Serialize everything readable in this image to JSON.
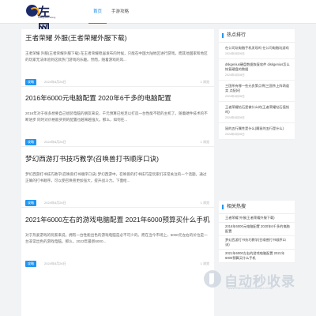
{
  "header": {
    "logo_text": "左网",
    "logo_sub": "Wang Zuo Wang",
    "nav": [
      "首页",
      "手游攻略"
    ]
  },
  "posts": [
    {
      "title": "王者荣耀 外服(王者荣耀外服下载)",
      "excerpt": "王者荣耀 外服(王者荣耀外服下载) 在王者荣耀稳居发布的时候，只能在中国大陆地区进行游戏，而其他国家和地区的玩家无法体验到这款热门游戏的乐趣。然而，随着游戏的风...",
      "tag": "攻略",
      "date": "2024年8月26日",
      "views": "1 浏览"
    },
    {
      "title": "2016年6000元电脑配置 2020年6千多的电脑配置",
      "excerpt": "2016年对于很多想要自己组装电脑的朋友来说，千元预算已经足以打造一台性能不错的主机了。随着硬件技术的不断进步 同时对价格能买到的配置也越来越强大。那么，如何在...",
      "tag": "攻略",
      "date": "2024年8月26日",
      "views": "1 浏览"
    },
    {
      "title": "梦幻西游打书技巧教学(召唤兽打书顺序口诀)",
      "excerpt": "梦幻西游打书技巧教学(召唤兽打书顺序口诀) 梦幻西游中，召唤兽的打书技巧是玩家们非常关注的一个话题。通过正确的打书顺序，可以使召唤兽更加强大，提升战斗力。下面给...",
      "tag": "攻略",
      "date": "2024年8月26日",
      "views": "1 浏览"
    },
    {
      "title": "2021年6000左右的游戏电脑配置 2021年6000预算买什么手机",
      "excerpt": "对于热爱游戏的玩家来说，拥有一台性能出色的游戏电脑是必不可少的。而在当今市场上，6000元左右的价位是一台非常出色的游戏电脑。那么，2023年最新6000...",
      "tag": "攻略",
      "date": "2024年8月26日",
      "views": "1 浏览"
    }
  ],
  "hot": {
    "heading": "热点排行",
    "items": [
      {
        "title": "在公司玩电脑手机发现吗 在公司电脑玩游戏",
        "date": "2024年8月26日"
      },
      {
        "title": "dskgenius硬盘数据恢复软件 diskgenius怎么恢复硬盘的数据",
        "date": "2024年8月26日"
      },
      {
        "title": "三国杀有哪一些元良策点将(三国杀上阵两道卖 点配好)",
        "date": "2024年8月26日"
      },
      {
        "title": "王者荣耀钻石是做什么的(王者荣耀钻石值钱吗)",
        "date": "2024年8月26日"
      },
      {
        "title": "鼠的五行属性是什么(属鼠的五行是什么)",
        "date": "2024年8月26日"
      }
    ]
  },
  "related": {
    "heading": "相关热搜",
    "items": [
      "王者荣耀 外服(王者荣耀外服下载)",
      "2016年6000元电脑配置 2020年6千多的电脑配置",
      "梦幻西游打书技巧教学(召唤兽打书顺序口诀)",
      "2021年6000左右的游戏电脑配置 2021年6000预算买什么手机"
    ]
  },
  "watermark": {
    "text": "自动秒收录",
    "url": "WWW.ZIDONGMIAOSHOULU.COM"
  }
}
